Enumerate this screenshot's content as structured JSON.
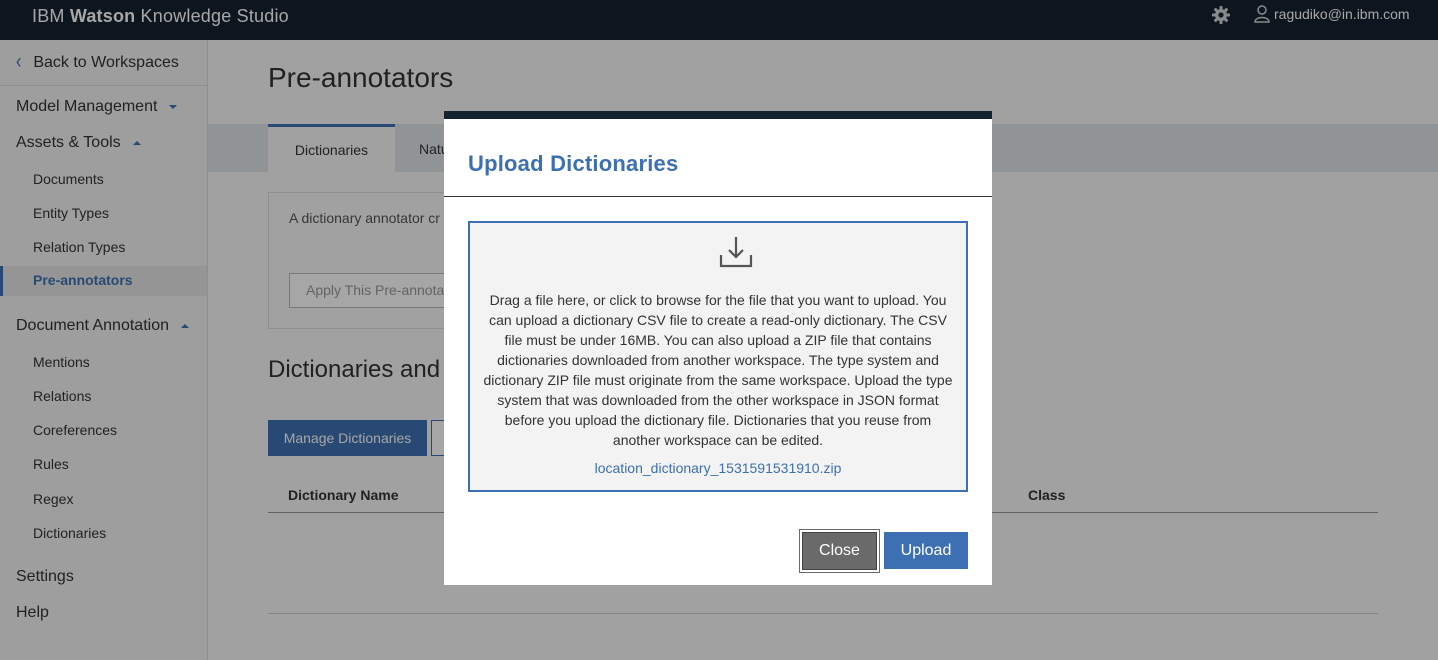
{
  "header": {
    "brand_regular": "IBM",
    "brand_bold": "Watson",
    "brand_suffix": "Knowledge Studio",
    "user_email": "ragudiko@in.ibm.com"
  },
  "sidebar": {
    "back_label": "Back to Workspaces",
    "model_management": "Model Management",
    "assets_tools": "Assets & Tools",
    "assets_items": [
      "Documents",
      "Entity Types",
      "Relation Types",
      "Pre-annotators"
    ],
    "document_annotation": "Document Annotation",
    "annotation_items": [
      "Mentions",
      "Relations",
      "Coreferences",
      "Rules",
      "Regex",
      "Dictionaries"
    ],
    "settings": "Settings",
    "help": "Help"
  },
  "main": {
    "title": "Pre-annotators",
    "tab_active": "Dictionaries",
    "tab_second": "Natu",
    "info_text": "A dictionary annotator cr that matches a term in a or class in order to apply",
    "apply_button": "Apply This Pre-annotat",
    "section_title": "Dictionaries and",
    "manage_button": "Manage Dictionaries",
    "col_dictionary_name": "Dictionary Name",
    "col_class": "Class"
  },
  "modal": {
    "title": "Upload Dictionaries",
    "drop_text": "Drag a file here, or click to browse for the file that you want to upload. You can upload a dictionary CSV file to create a read-only dictionary. The CSV file must be under 16MB. You can also upload a ZIP file that contains dictionaries downloaded from another workspace. The type system and dictionary ZIP file must originate from the same workspace. Upload the type system that was downloaded from the other workspace in JSON format before you upload the dictionary file. Dictionaries that you reuse from another workspace can be edited.",
    "file_name": "location_dictionary_1531591531910.zip",
    "close_label": "Close",
    "upload_label": "Upload"
  },
  "colors": {
    "accent": "#3d70b2",
    "header_bg": "#15232f"
  }
}
